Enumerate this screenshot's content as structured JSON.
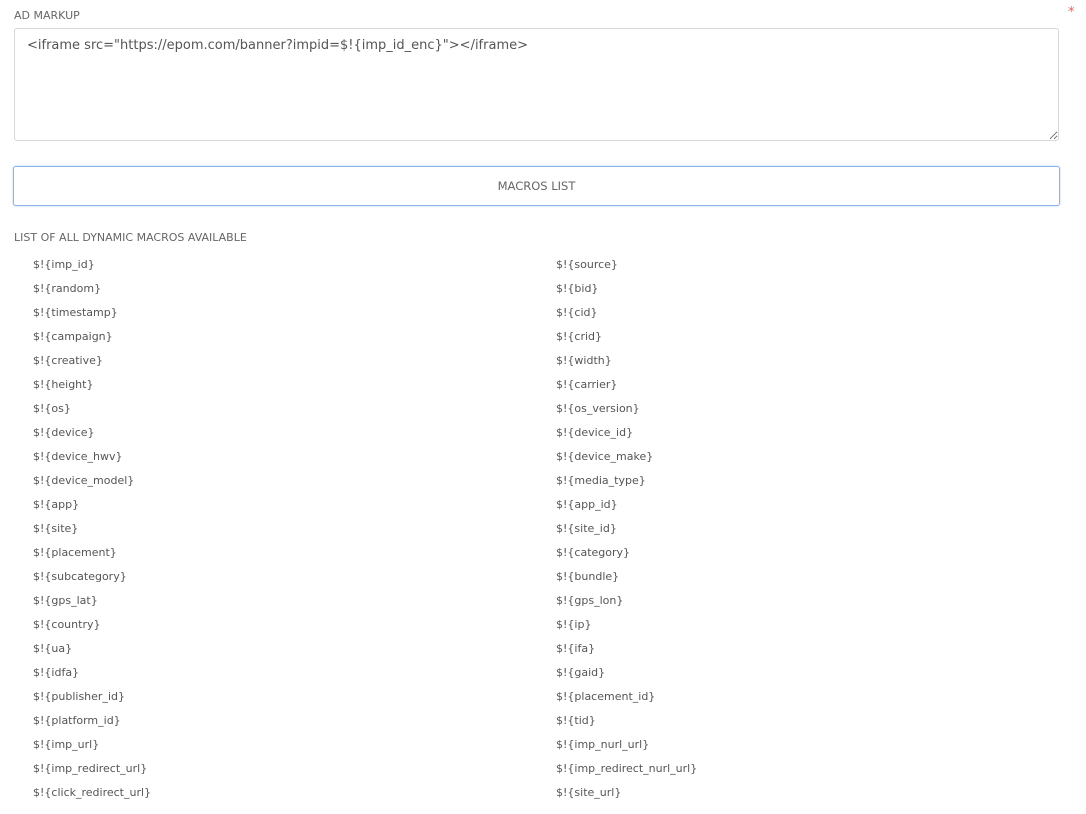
{
  "ad_markup": {
    "label": "AD MARKUP",
    "required_marker": "*",
    "value": "<iframe src=\"https://epom.com/banner?impid=$!{imp_id_enc}\"></iframe>"
  },
  "macros_button": {
    "label": "MACROS LIST"
  },
  "macros_list": {
    "heading": "LIST OF ALL DYNAMIC MACROS AVAILABLE",
    "left_column": [
      "$!{imp_id}",
      "$!{random}",
      "$!{timestamp}",
      "$!{campaign}",
      "$!{creative}",
      "$!{height}",
      "$!{os}",
      "$!{device}",
      "$!{device_hwv}",
      "$!{device_model}",
      "$!{app}",
      "$!{site}",
      "$!{placement}",
      "$!{subcategory}",
      "$!{gps_lat}",
      "$!{country}",
      "$!{ua}",
      "$!{idfa}",
      "$!{publisher_id}",
      "$!{platform_id}",
      "$!{imp_url}",
      "$!{imp_redirect_url}",
      "$!{click_redirect_url}"
    ],
    "right_column": [
      "$!{source}",
      "$!{bid}",
      "$!{cid}",
      "$!{crid}",
      "$!{width}",
      "$!{carrier}",
      "$!{os_version}",
      "$!{device_id}",
      "$!{device_make}",
      "$!{media_type}",
      "$!{app_id}",
      "$!{site_id}",
      "$!{category}",
      "$!{bundle}",
      "$!{gps_lon}",
      "$!{ip}",
      "$!{ifa}",
      "$!{gaid}",
      "$!{placement_id}",
      "$!{tid}",
      "$!{imp_nurl_url}",
      "$!{imp_redirect_nurl_url}",
      "$!{site_url}"
    ]
  }
}
